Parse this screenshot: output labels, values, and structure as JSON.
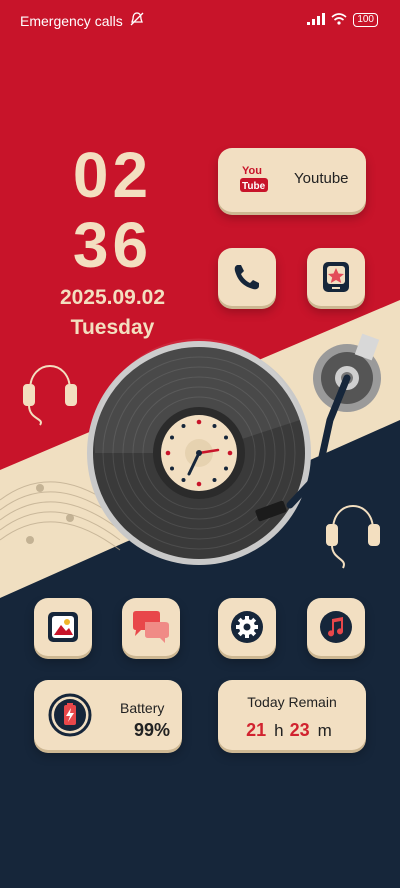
{
  "status_bar": {
    "carrier_text": "Emergency calls",
    "battery": "100"
  },
  "clock": {
    "hours": "02",
    "minutes": "36",
    "date": "2025.09.02",
    "weekday": "Tuesday"
  },
  "widgets": {
    "youtube": {
      "label": "Youtube",
      "logo_top": "You",
      "logo_bottom": "Tube"
    },
    "battery": {
      "label": "Battery",
      "value": "99%"
    },
    "today_remain": {
      "label": "Today Remain",
      "hours": "21",
      "hours_unit": "h",
      "minutes": "23",
      "minutes_unit": "m"
    }
  },
  "apps": [
    {
      "name": "phone",
      "icon": "phone-icon"
    },
    {
      "name": "store",
      "icon": "star-store-icon"
    },
    {
      "name": "gallery",
      "icon": "gallery-icon"
    },
    {
      "name": "messages",
      "icon": "chat-bubbles-icon"
    },
    {
      "name": "settings",
      "icon": "gear-icon"
    },
    {
      "name": "music",
      "icon": "music-note-icon"
    }
  ],
  "colors": {
    "red": "#c8142a",
    "cream": "#f2dfc2",
    "navy": "#16263a",
    "accent": "#d1232f"
  }
}
